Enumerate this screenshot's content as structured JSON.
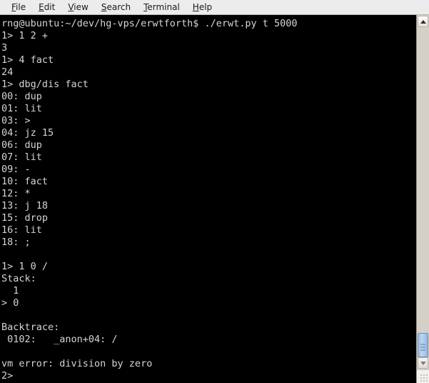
{
  "window": {
    "kind": "terminal-emulator",
    "background_color": "#000000",
    "foreground_color": "#d3d7cf",
    "menubar_color": "#ececec"
  },
  "menubar": {
    "items": [
      {
        "label": "File",
        "mnemonic": "F"
      },
      {
        "label": "Edit",
        "mnemonic": "E"
      },
      {
        "label": "View",
        "mnemonic": "V"
      },
      {
        "label": "Search",
        "mnemonic": "S"
      },
      {
        "label": "Terminal",
        "mnemonic": "T"
      },
      {
        "label": "Help",
        "mnemonic": "H"
      }
    ]
  },
  "terminal": {
    "lines": [
      "rng@ubuntu:~/dev/hg-vps/erwtforth$ ./erwt.py t 5000",
      "1> 1 2 +",
      "3",
      "1> 4 fact",
      "24",
      "1> dbg/dis fact",
      "00: dup",
      "01: lit",
      "03: >",
      "04: jz 15",
      "06: dup",
      "07: lit",
      "09: -",
      "10: fact",
      "12: *",
      "13: j 18",
      "15: drop",
      "16: lit",
      "18: ;",
      "",
      "1> 1 0 /",
      "Stack:",
      "  1",
      "> 0",
      "",
      "Backtrace:",
      " 0102:   _anon+04: /",
      "",
      "vm error: division by zero",
      "2>"
    ]
  },
  "scrollbar": {
    "up_arrow": "triangle-up",
    "down_arrow": "triangle-down",
    "thumb_color": "#a9c6e8",
    "trough_color": "#d4d0c8",
    "position": "bottom"
  }
}
